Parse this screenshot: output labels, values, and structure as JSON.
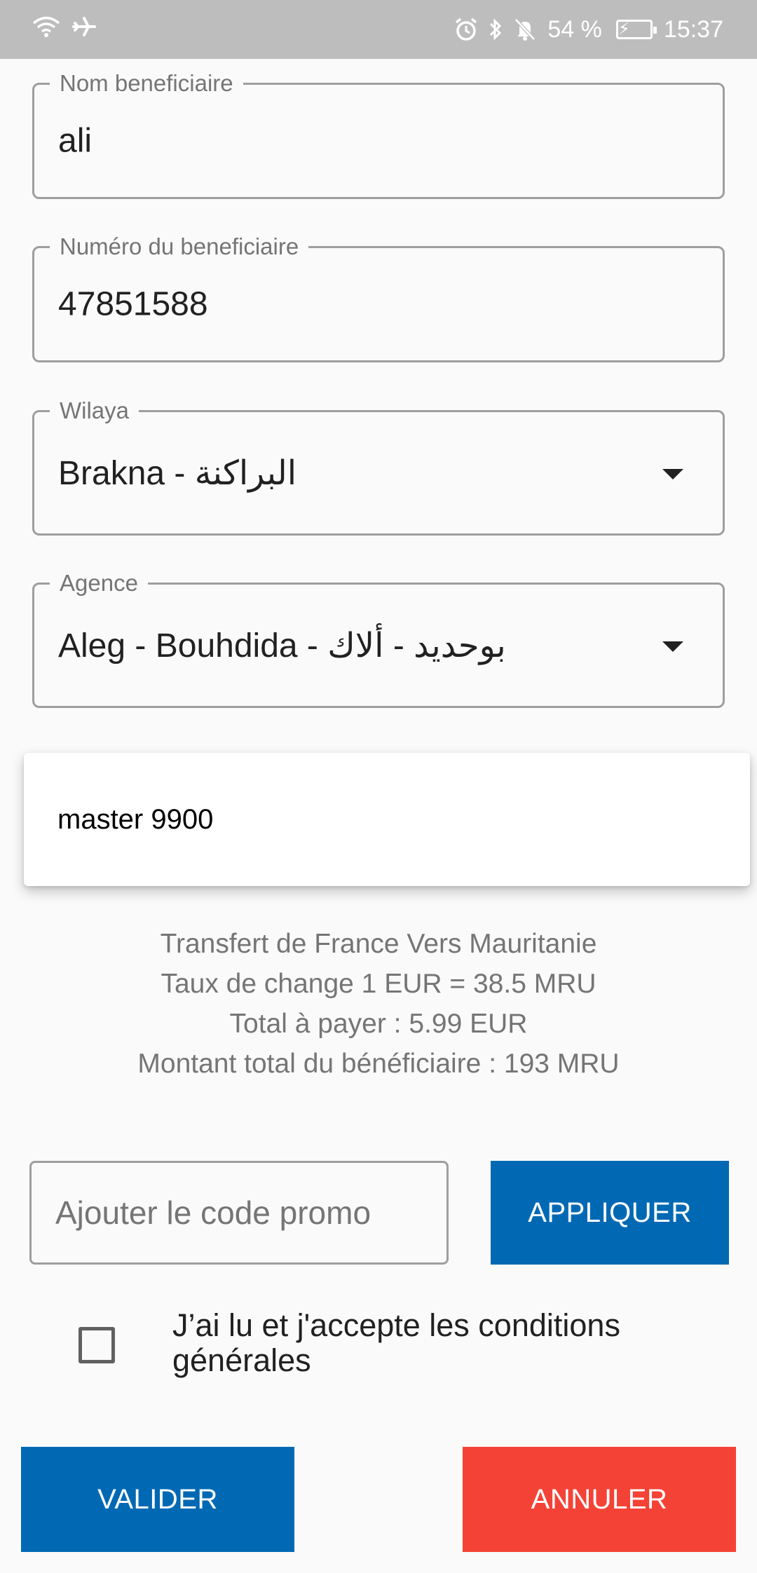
{
  "status_bar": {
    "left_icons": [
      "wifi-icon",
      "airplane-icon"
    ],
    "right_icons": [
      "alarm-icon",
      "bluetooth-icon",
      "mute-icon",
      "battery-icon"
    ],
    "battery": "54 %",
    "time": "15:37"
  },
  "form": {
    "beneficiary_name": {
      "label": "Nom beneficiaire",
      "value": "ali"
    },
    "beneficiary_number": {
      "label": "Numéro du beneficiaire",
      "value": "47851588"
    },
    "wilaya": {
      "label": "Wilaya",
      "value": "Brakna - البراكنة"
    },
    "agence": {
      "label": "Agence",
      "value": "Aleg - Bouhdida - بوحديد - ألاك"
    }
  },
  "popup": {
    "items": [
      "master 9900"
    ]
  },
  "info": {
    "line1": "Transfert de France Vers Mauritanie",
    "line2": "Taux de change 1  EUR = 38.5 MRU",
    "line3": "Total à payer : 5.99 EUR",
    "line4": "Montant total du bénéficiaire :  193 MRU"
  },
  "promo": {
    "placeholder": "Ajouter le code promo",
    "value": "",
    "apply_label": "APPLIQUER"
  },
  "terms": {
    "checked": false,
    "label": "J’ai lu et j'accepte les conditions générales"
  },
  "actions": {
    "validate_label": "VALIDER",
    "cancel_label": "ANNULER"
  },
  "colors": {
    "primary": "#0169b4",
    "danger": "#f44336",
    "status_bar": "#bdbdbd",
    "border": "#9e9e9e",
    "muted_text": "#757575"
  }
}
